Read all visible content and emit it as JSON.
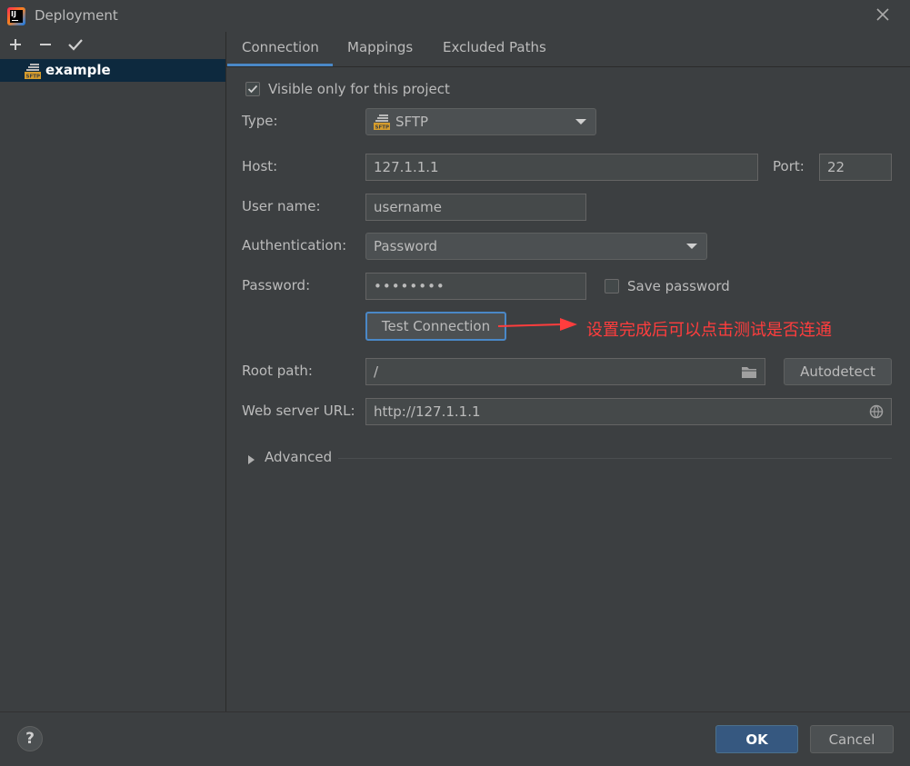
{
  "window": {
    "title": "Deployment"
  },
  "toolbar": {
    "add": "+",
    "remove": "−",
    "apply": "✔"
  },
  "servers": [
    {
      "name": "example",
      "icon": "sftp-server-icon"
    }
  ],
  "tabs": [
    {
      "label": "Connection",
      "active": true
    },
    {
      "label": "Mappings"
    },
    {
      "label": "Excluded Paths"
    }
  ],
  "form": {
    "visible_only": {
      "label": "Visible only for this project",
      "checked": true
    },
    "type": {
      "label": "Type:",
      "value": "SFTP"
    },
    "host": {
      "label": "Host:",
      "value": "127.1.1.1"
    },
    "port": {
      "label": "Port:",
      "value": "22"
    },
    "username": {
      "label": "User name:",
      "value": "username"
    },
    "authentication": {
      "label": "Authentication:",
      "value": "Password"
    },
    "password": {
      "label": "Password:",
      "value": "••••••••"
    },
    "save_password": {
      "label": "Save password",
      "checked": false
    },
    "test_connection": "Test Connection",
    "root_path": {
      "label": "Root path:",
      "value": "/"
    },
    "autodetect": "Autodetect",
    "web_url": {
      "label": "Web server URL:",
      "value": "http://127.1.1.1"
    },
    "advanced": "Advanced"
  },
  "annotation": "设置完成后可以点击测试是否连通",
  "footer": {
    "help": "?",
    "ok": "OK",
    "cancel": "Cancel"
  },
  "colors": {
    "accent": "#4a88c7",
    "selection": "#0d293e",
    "annotation": "#ff3d3d",
    "ok_button": "#365880"
  }
}
